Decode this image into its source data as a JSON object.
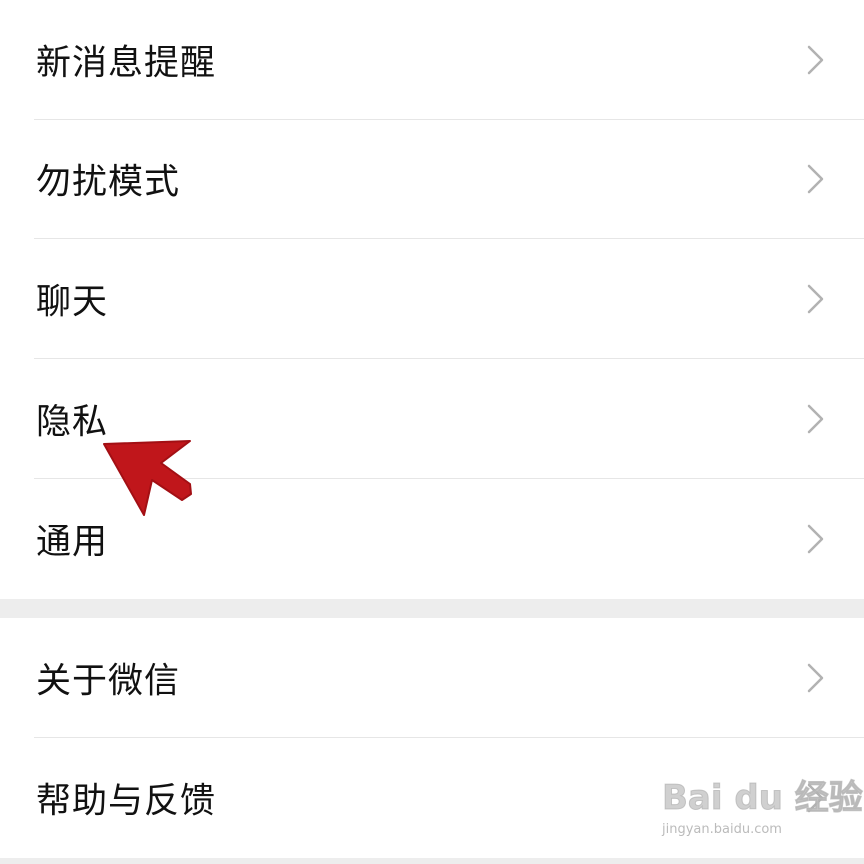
{
  "settings": {
    "group1": [
      {
        "label": "新消息提醒"
      },
      {
        "label": "勿扰模式"
      },
      {
        "label": "聊天"
      },
      {
        "label": "隐私"
      },
      {
        "label": "通用"
      }
    ],
    "group2": [
      {
        "label": "关于微信"
      },
      {
        "label": "帮助与反馈"
      }
    ]
  },
  "annotation": {
    "arrow_color": "#c0161b",
    "points_to": "隐私"
  },
  "watermark": {
    "logo": "Bai du 经验",
    "url": "jingyan.baidu.com"
  },
  "colors": {
    "background": "#ffffff",
    "section_gap": "#ededed",
    "divider": "#e6e6e6",
    "chevron": "#b2b2b2",
    "text": "#111111"
  }
}
